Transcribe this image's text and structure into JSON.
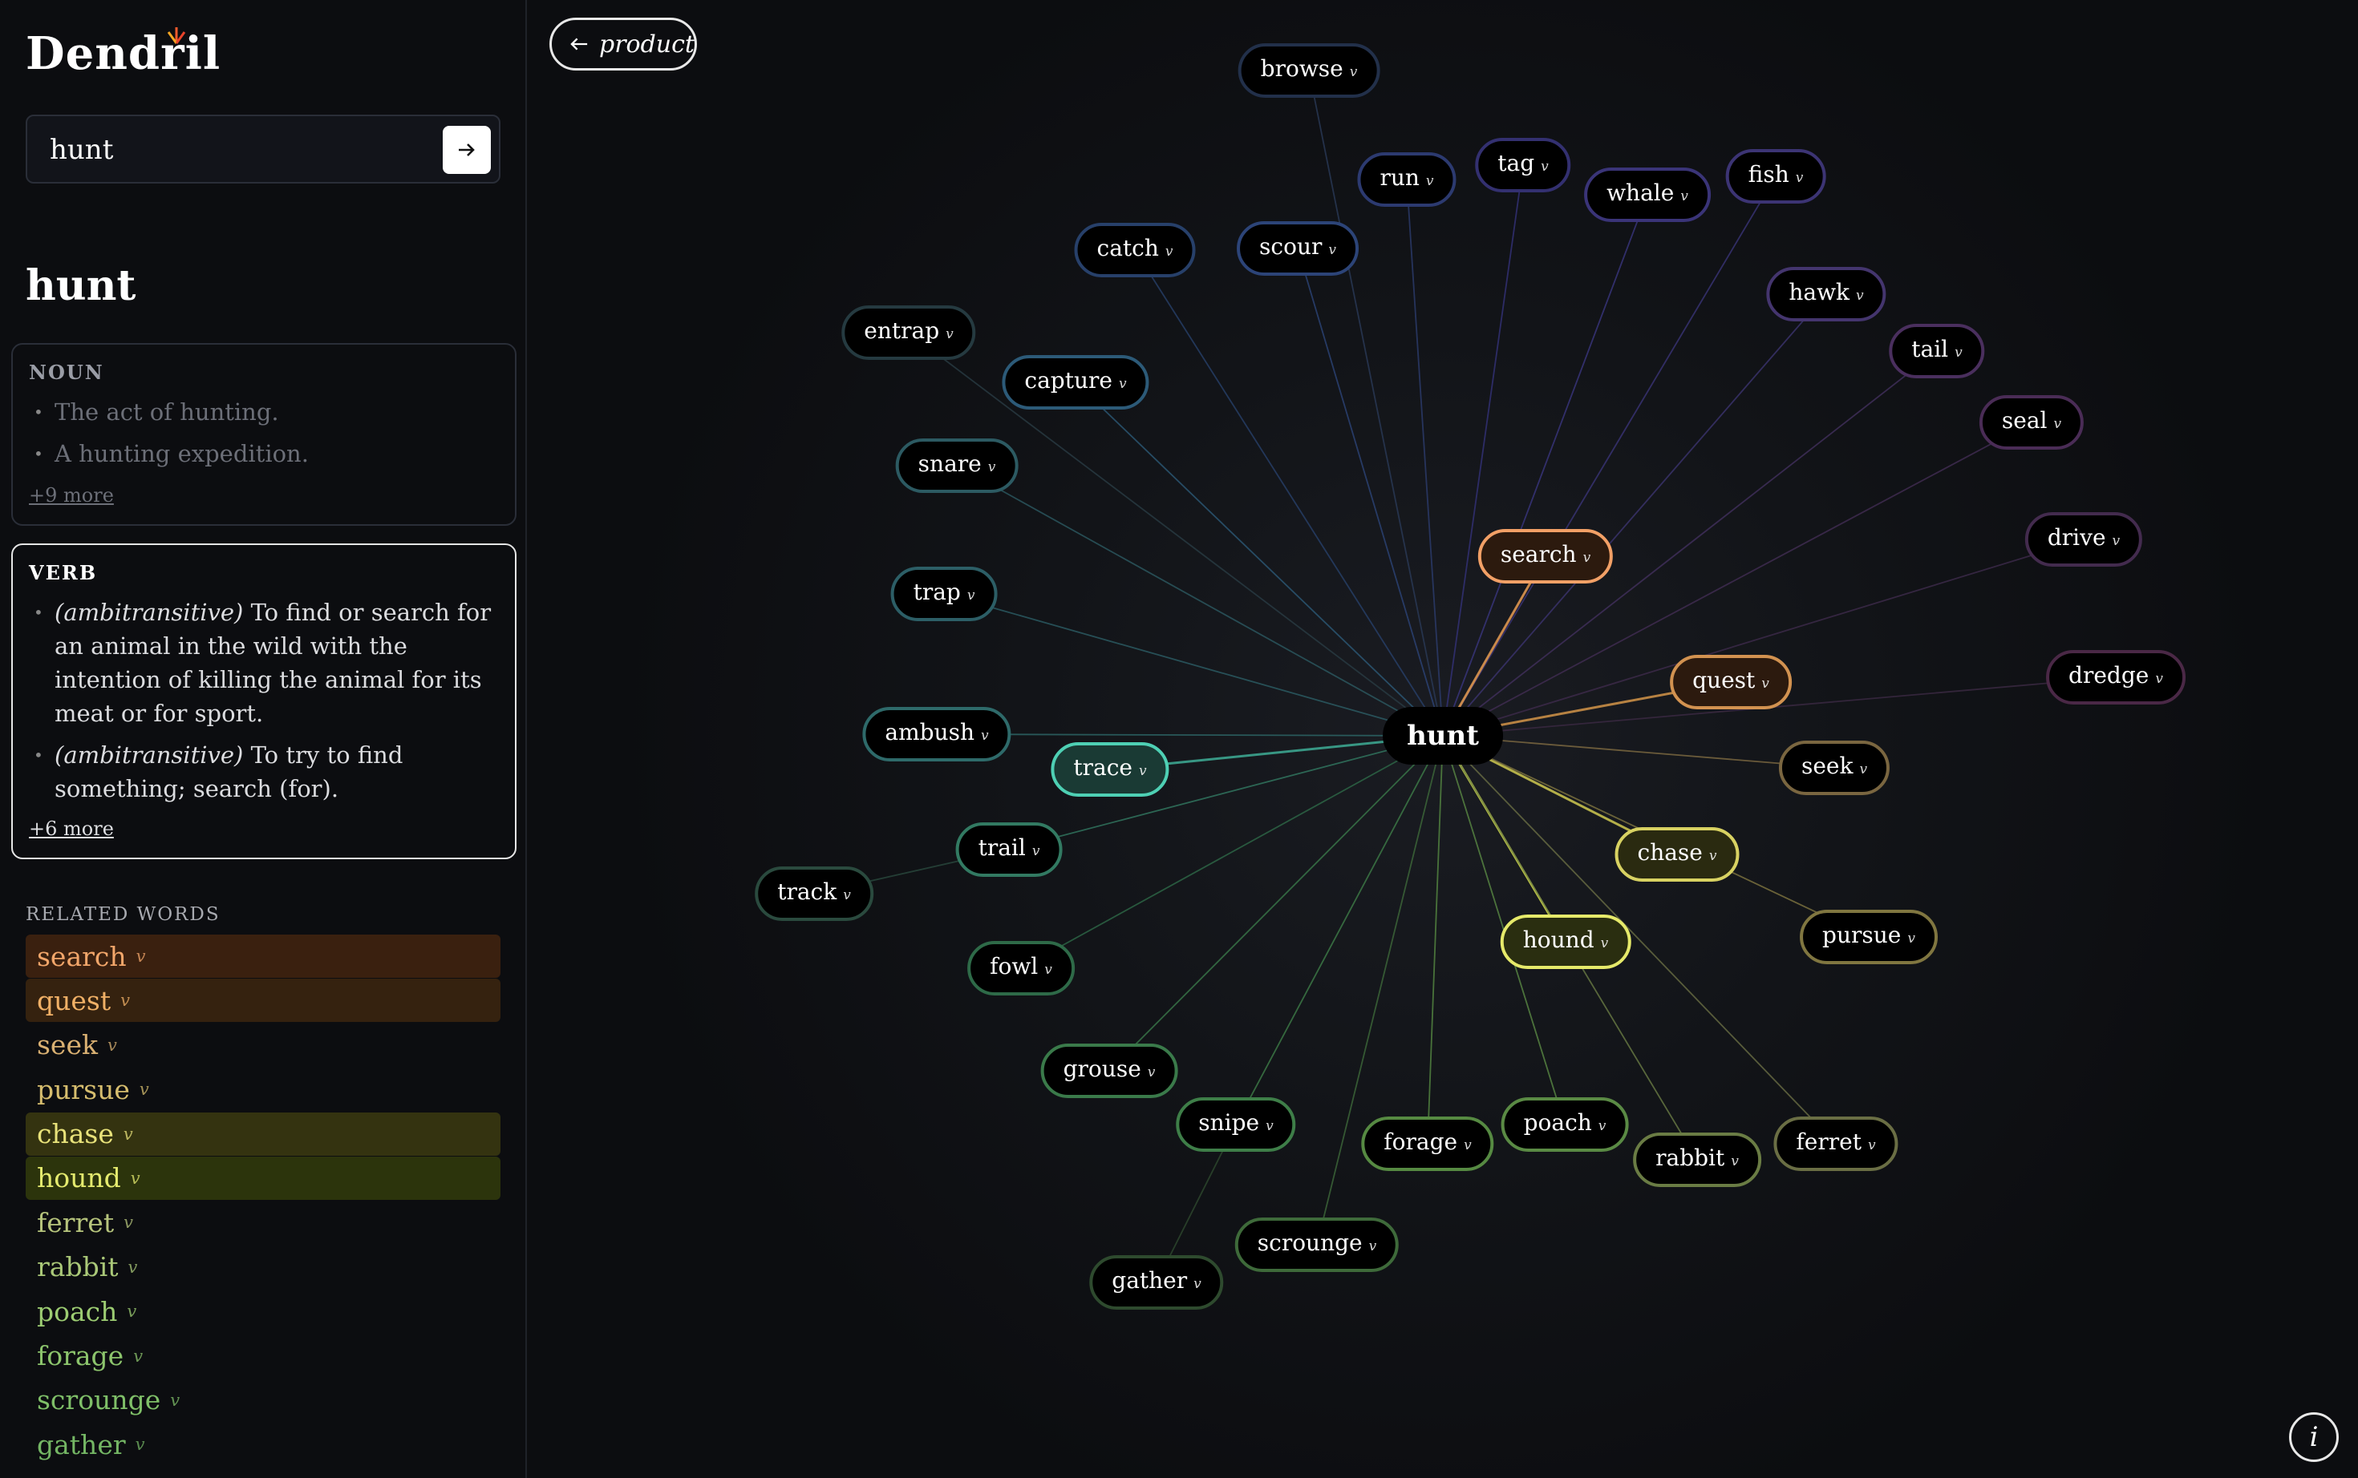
{
  "app": {
    "name": "Dendril"
  },
  "search": {
    "value": "hunt"
  },
  "word": "hunt",
  "noun": {
    "label": "NOUN",
    "defs": [
      "The act of hunting.",
      "A hunting expedition."
    ],
    "more": "+9 more"
  },
  "verb": {
    "label": "VERB",
    "defs": [
      {
        "gram": "(ambitransitive)",
        "text": "To find or search for an animal in the wild with the intention of killing the animal for its meat or for sport."
      },
      {
        "gram": "(ambitransitive)",
        "text": "To try to find something; search (for)."
      }
    ],
    "more": "+6 more"
  },
  "related": {
    "heading": "RELATED WORDS",
    "items": [
      {
        "word": "search",
        "pos": "v",
        "color": "#f2a66a",
        "bg": "#3a200f"
      },
      {
        "word": "quest",
        "pos": "v",
        "color": "#f0b066",
        "bg": "#35220f"
      },
      {
        "word": "seek",
        "pos": "v",
        "color": "#d9b072",
        "bg": ""
      },
      {
        "word": "pursue",
        "pos": "v",
        "color": "#d6bd6e",
        "bg": ""
      },
      {
        "word": "chase",
        "pos": "v",
        "color": "#e8e27a",
        "bg": "#343310"
      },
      {
        "word": "hound",
        "pos": "v",
        "color": "#e4ea6e",
        "bg": "#2c340c"
      },
      {
        "word": "ferret",
        "pos": "v",
        "color": "#b6c47c",
        "bg": ""
      },
      {
        "word": "rabbit",
        "pos": "v",
        "color": "#aac878",
        "bg": ""
      },
      {
        "word": "poach",
        "pos": "v",
        "color": "#9ccc72",
        "bg": ""
      },
      {
        "word": "forage",
        "pos": "v",
        "color": "#8cc46c",
        "bg": ""
      },
      {
        "word": "scrounge",
        "pos": "v",
        "color": "#7fbf68",
        "bg": ""
      },
      {
        "word": "gather",
        "pos": "v",
        "color": "#74b664",
        "bg": ""
      }
    ]
  },
  "graph": {
    "back_label": "product",
    "info_label": "i",
    "center": "hunt",
    "nodes": [
      {
        "word": "browse",
        "pos": "v",
        "border": "#22304a",
        "line": "#2a3a58",
        "bg": "#000"
      },
      {
        "word": "run",
        "pos": "v",
        "border": "#2c3a70",
        "line": "#2c3c6e",
        "bg": "#000"
      },
      {
        "word": "tag",
        "pos": "v",
        "border": "#333070",
        "line": "#34327a",
        "bg": "#000"
      },
      {
        "word": "whale",
        "pos": "v",
        "border": "#3a3478",
        "line": "#3a3680",
        "bg": "#000"
      },
      {
        "word": "fish",
        "pos": "v",
        "border": "#3c3474",
        "line": "#3a3478",
        "bg": "#000"
      },
      {
        "word": "catch",
        "pos": "v",
        "border": "#27406a",
        "line": "#27406a",
        "bg": "#000"
      },
      {
        "word": "scour",
        "pos": "v",
        "border": "#2c4478",
        "line": "#2c4478",
        "bg": "#000"
      },
      {
        "word": "hawk",
        "pos": "v",
        "border": "#44356e",
        "line": "#3c3470",
        "bg": "#000"
      },
      {
        "word": "tail",
        "pos": "v",
        "border": "#4a2f5e",
        "line": "#42305e",
        "bg": "#000"
      },
      {
        "word": "seal",
        "pos": "v",
        "border": "#4a2c56",
        "line": "#422d54",
        "bg": "#000"
      },
      {
        "word": "drive",
        "pos": "v",
        "border": "#432b4e",
        "line": "#3e2b4c",
        "bg": "#000"
      },
      {
        "word": "dredge",
        "pos": "v",
        "border": "#4a2846",
        "line": "#3c2a44",
        "bg": "#000"
      },
      {
        "word": "entrap",
        "pos": "v",
        "border": "#253a40",
        "line": "#293c44",
        "bg": "#000"
      },
      {
        "word": "capture",
        "pos": "v",
        "border": "#2c5a78",
        "line": "#2c5a78",
        "bg": "#000"
      },
      {
        "word": "snare",
        "pos": "v",
        "border": "#2c5a62",
        "line": "#2c5a62",
        "bg": "#000"
      },
      {
        "word": "trap",
        "pos": "v",
        "border": "#2c5e66",
        "line": "#2c5e66",
        "bg": "#000"
      },
      {
        "word": "search",
        "pos": "v",
        "border": "#f2a066",
        "line": "#d4904e",
        "bg": "#2c1a0e"
      },
      {
        "word": "quest",
        "pos": "v",
        "border": "#d29250",
        "line": "#c08844",
        "bg": "#2c1a0e"
      },
      {
        "word": "seek",
        "pos": "v",
        "border": "#7a6640",
        "line": "#806c42",
        "bg": "#000"
      },
      {
        "word": "ambush",
        "pos": "v",
        "border": "#2e6a6a",
        "line": "#2e6a6a",
        "bg": "#000"
      },
      {
        "word": "trace",
        "pos": "v",
        "border": "#4ed0b4",
        "line": "#3a9e8a",
        "bg": "#1a3a34"
      },
      {
        "word": "trail",
        "pos": "v",
        "border": "#327a62",
        "line": "#327a62",
        "bg": "#000"
      },
      {
        "word": "track",
        "pos": "v",
        "border": "#2a4a3e",
        "line": "#2a4a3e",
        "bg": "#000"
      },
      {
        "word": "chase",
        "pos": "v",
        "border": "#d8d262",
        "line": "#bdb84c",
        "bg": "#2a2a10"
      },
      {
        "word": "pursue",
        "pos": "v",
        "border": "#807640",
        "line": "#807640",
        "bg": "#000"
      },
      {
        "word": "hound",
        "pos": "v",
        "border": "#e6ea6a",
        "line": "#c4cc48",
        "bg": "#2a2e10"
      },
      {
        "word": "fowl",
        "pos": "v",
        "border": "#2e6a48",
        "line": "#2e6a48",
        "bg": "#000"
      },
      {
        "word": "grouse",
        "pos": "v",
        "border": "#3a7a4a",
        "line": "#3a7a4a",
        "bg": "#000"
      },
      {
        "word": "snipe",
        "pos": "v",
        "border": "#3e7e48",
        "line": "#3e7e48",
        "bg": "#000"
      },
      {
        "word": "forage",
        "pos": "v",
        "border": "#568a42",
        "line": "#568a42",
        "bg": "#000"
      },
      {
        "word": "poach",
        "pos": "v",
        "border": "#5a8a44",
        "line": "#5a8a44",
        "bg": "#000"
      },
      {
        "word": "rabbit",
        "pos": "v",
        "border": "#6a7c44",
        "line": "#6a7c44",
        "bg": "#000"
      },
      {
        "word": "ferret",
        "pos": "v",
        "border": "#6a6e44",
        "line": "#6a6e44",
        "bg": "#000"
      },
      {
        "word": "scrounge",
        "pos": "v",
        "border": "#3e6a3a",
        "line": "#3e6a3a",
        "bg": "#000"
      },
      {
        "word": "gather",
        "pos": "v",
        "border": "#2e4a2e",
        "line": "#2e4a2e",
        "bg": "#000"
      }
    ]
  }
}
